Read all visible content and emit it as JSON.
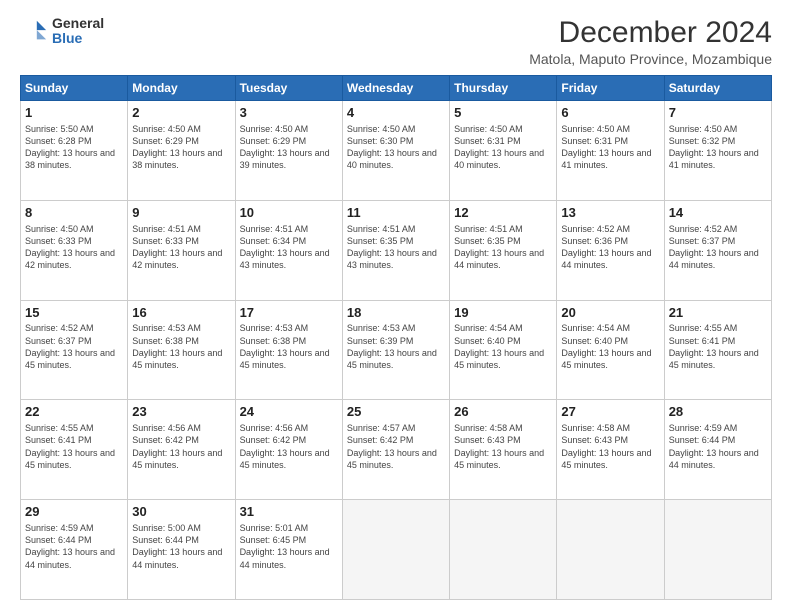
{
  "logo": {
    "general": "General",
    "blue": "Blue"
  },
  "header": {
    "title": "December 2024",
    "subtitle": "Matola, Maputo Province, Mozambique"
  },
  "weekdays": [
    "Sunday",
    "Monday",
    "Tuesday",
    "Wednesday",
    "Thursday",
    "Friday",
    "Saturday"
  ],
  "weeks": [
    [
      {
        "day": "1",
        "sunrise": "5:50 AM",
        "sunset": "6:28 PM",
        "daylight": "13 hours and 38 minutes."
      },
      {
        "day": "2",
        "sunrise": "4:50 AM",
        "sunset": "6:29 PM",
        "daylight": "13 hours and 38 minutes."
      },
      {
        "day": "3",
        "sunrise": "4:50 AM",
        "sunset": "6:29 PM",
        "daylight": "13 hours and 39 minutes."
      },
      {
        "day": "4",
        "sunrise": "4:50 AM",
        "sunset": "6:30 PM",
        "daylight": "13 hours and 40 minutes."
      },
      {
        "day": "5",
        "sunrise": "4:50 AM",
        "sunset": "6:31 PM",
        "daylight": "13 hours and 40 minutes."
      },
      {
        "day": "6",
        "sunrise": "4:50 AM",
        "sunset": "6:31 PM",
        "daylight": "13 hours and 41 minutes."
      },
      {
        "day": "7",
        "sunrise": "4:50 AM",
        "sunset": "6:32 PM",
        "daylight": "13 hours and 41 minutes."
      }
    ],
    [
      {
        "day": "8",
        "sunrise": "4:50 AM",
        "sunset": "6:33 PM",
        "daylight": "13 hours and 42 minutes."
      },
      {
        "day": "9",
        "sunrise": "4:51 AM",
        "sunset": "6:33 PM",
        "daylight": "13 hours and 42 minutes."
      },
      {
        "day": "10",
        "sunrise": "4:51 AM",
        "sunset": "6:34 PM",
        "daylight": "13 hours and 43 minutes."
      },
      {
        "day": "11",
        "sunrise": "4:51 AM",
        "sunset": "6:35 PM",
        "daylight": "13 hours and 43 minutes."
      },
      {
        "day": "12",
        "sunrise": "4:51 AM",
        "sunset": "6:35 PM",
        "daylight": "13 hours and 44 minutes."
      },
      {
        "day": "13",
        "sunrise": "4:52 AM",
        "sunset": "6:36 PM",
        "daylight": "13 hours and 44 minutes."
      },
      {
        "day": "14",
        "sunrise": "4:52 AM",
        "sunset": "6:37 PM",
        "daylight": "13 hours and 44 minutes."
      }
    ],
    [
      {
        "day": "15",
        "sunrise": "4:52 AM",
        "sunset": "6:37 PM",
        "daylight": "13 hours and 45 minutes."
      },
      {
        "day": "16",
        "sunrise": "4:53 AM",
        "sunset": "6:38 PM",
        "daylight": "13 hours and 45 minutes."
      },
      {
        "day": "17",
        "sunrise": "4:53 AM",
        "sunset": "6:38 PM",
        "daylight": "13 hours and 45 minutes."
      },
      {
        "day": "18",
        "sunrise": "4:53 AM",
        "sunset": "6:39 PM",
        "daylight": "13 hours and 45 minutes."
      },
      {
        "day": "19",
        "sunrise": "4:54 AM",
        "sunset": "6:40 PM",
        "daylight": "13 hours and 45 minutes."
      },
      {
        "day": "20",
        "sunrise": "4:54 AM",
        "sunset": "6:40 PM",
        "daylight": "13 hours and 45 minutes."
      },
      {
        "day": "21",
        "sunrise": "4:55 AM",
        "sunset": "6:41 PM",
        "daylight": "13 hours and 45 minutes."
      }
    ],
    [
      {
        "day": "22",
        "sunrise": "4:55 AM",
        "sunset": "6:41 PM",
        "daylight": "13 hours and 45 minutes."
      },
      {
        "day": "23",
        "sunrise": "4:56 AM",
        "sunset": "6:42 PM",
        "daylight": "13 hours and 45 minutes."
      },
      {
        "day": "24",
        "sunrise": "4:56 AM",
        "sunset": "6:42 PM",
        "daylight": "13 hours and 45 minutes."
      },
      {
        "day": "25",
        "sunrise": "4:57 AM",
        "sunset": "6:42 PM",
        "daylight": "13 hours and 45 minutes."
      },
      {
        "day": "26",
        "sunrise": "4:58 AM",
        "sunset": "6:43 PM",
        "daylight": "13 hours and 45 minutes."
      },
      {
        "day": "27",
        "sunrise": "4:58 AM",
        "sunset": "6:43 PM",
        "daylight": "13 hours and 45 minutes."
      },
      {
        "day": "28",
        "sunrise": "4:59 AM",
        "sunset": "6:44 PM",
        "daylight": "13 hours and 44 minutes."
      }
    ],
    [
      {
        "day": "29",
        "sunrise": "4:59 AM",
        "sunset": "6:44 PM",
        "daylight": "13 hours and 44 minutes."
      },
      {
        "day": "30",
        "sunrise": "5:00 AM",
        "sunset": "6:44 PM",
        "daylight": "13 hours and 44 minutes."
      },
      {
        "day": "31",
        "sunrise": "5:01 AM",
        "sunset": "6:45 PM",
        "daylight": "13 hours and 44 minutes."
      },
      null,
      null,
      null,
      null
    ]
  ]
}
